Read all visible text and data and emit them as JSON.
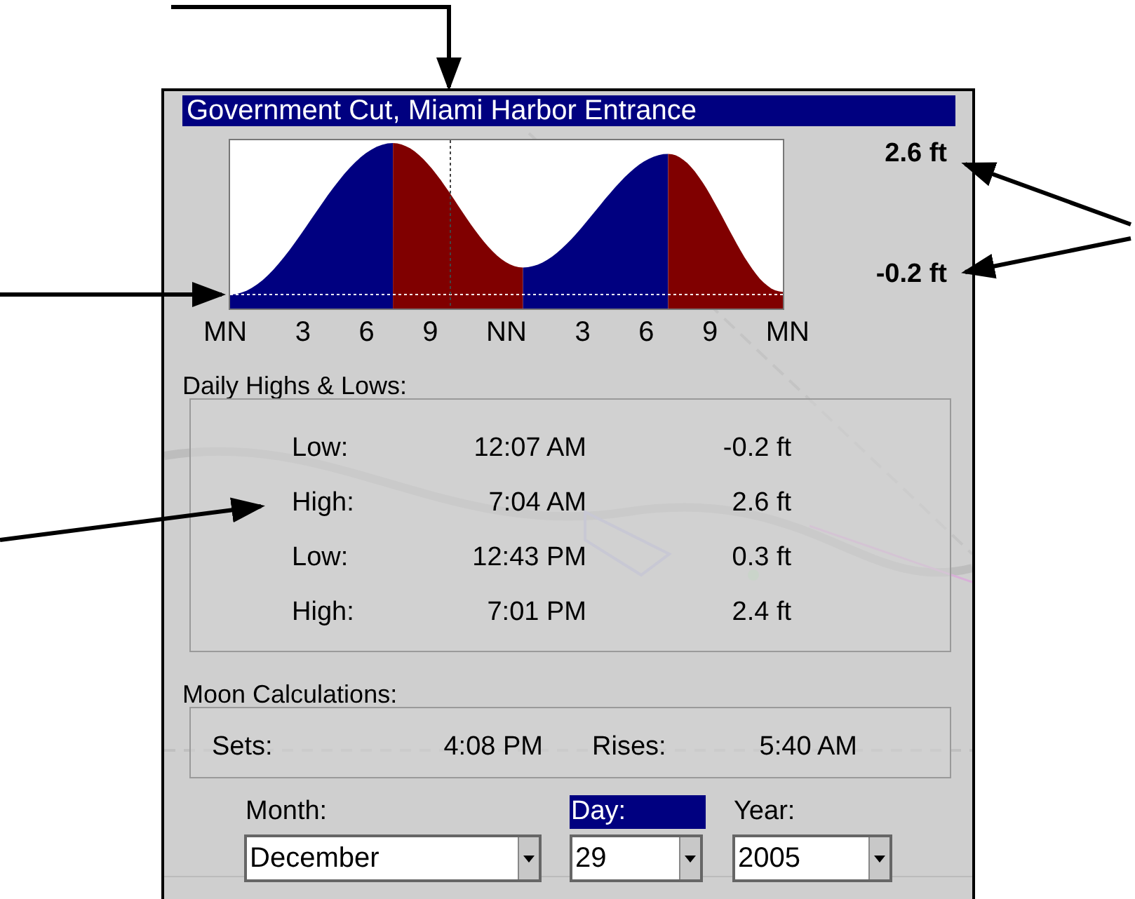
{
  "window": {
    "title": "Government Cut, Miami Harbor Entrance"
  },
  "tide_graph": {
    "max_label": "2.6 ft",
    "min_label": "-0.2 ft",
    "hour_labels": [
      "MN",
      "3",
      "6",
      "9",
      "NN",
      "3",
      "6",
      "9",
      "MN"
    ]
  },
  "daily_highs_lows": {
    "heading": "Daily Highs & Lows:",
    "rows": [
      {
        "label": "Low:",
        "time": "12:07 AM",
        "height": "-0.2 ft"
      },
      {
        "label": "High:",
        "time": "7:04 AM",
        "height": "2.6 ft"
      },
      {
        "label": "Low:",
        "time": "12:43 PM",
        "height": "0.3 ft"
      },
      {
        "label": "High:",
        "time": "7:01 PM",
        "height": "2.4 ft"
      }
    ]
  },
  "moon": {
    "heading": "Moon Calculations:",
    "sets_label": "Sets:",
    "sets_time": "4:08 PM",
    "rises_label": "Rises:",
    "rises_time": "5:40 AM"
  },
  "fields": [
    {
      "label": "Month:",
      "value": "December",
      "selected": false
    },
    {
      "label": "Day:",
      "value": "29",
      "selected": true
    },
    {
      "label": "Year:",
      "value": "2005",
      "selected": false
    }
  ]
}
